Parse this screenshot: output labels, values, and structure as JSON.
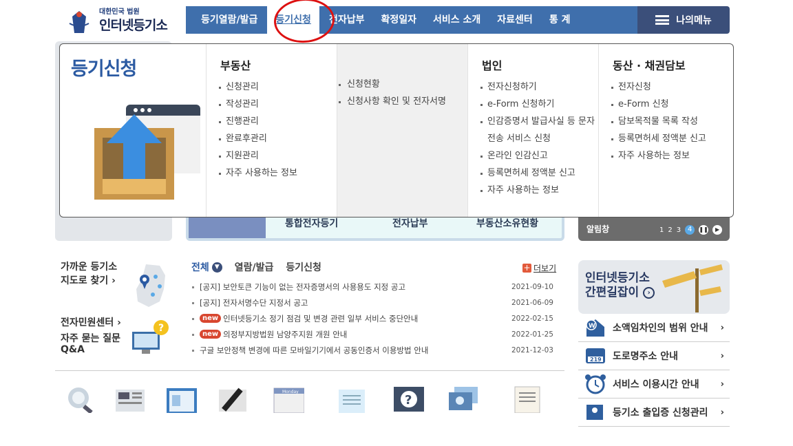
{
  "logo": {
    "small": "대한민국 법원",
    "big": "인터넷등기소"
  },
  "nav": {
    "items": [
      "등기열람/발급",
      "등기신청",
      "전자납부",
      "확정일자",
      "서비스 소개",
      "자료센터",
      "통 계"
    ],
    "active_index": 1,
    "my_menu": "나의메뉴"
  },
  "mega": {
    "title": "등기신청",
    "columns": [
      {
        "heading": "부동산",
        "items": [
          "신청관리",
          "작성관리",
          "진행관리",
          "완료후관리",
          "지원관리",
          "자주 사용하는 정보"
        ]
      },
      {
        "heading": "",
        "items": [
          "신청현황",
          "신청사항 확인 및 전자서명"
        ]
      },
      {
        "heading": "법인",
        "items": [
          "전자신청하기",
          "e-Form 신청하기",
          "인감증명서 발급사실 등 문자전송 서비스 신청",
          "온라인 인감신고",
          "등록면허세 정액분 신고",
          "자주 사용하는 정보"
        ]
      },
      {
        "heading": "동산 · 채권담보",
        "items": [
          "전자신청",
          "e-Form 신청",
          "담보목적물 목록 작성",
          "등록면허세 정액분 신고",
          "자주 사용하는 정보"
        ]
      }
    ]
  },
  "quick": {
    "items": [
      "통합전자등기",
      "전자납부",
      "부동산소유현황"
    ]
  },
  "notice_bar": {
    "label": "알림창",
    "pages": [
      "1",
      "2",
      "3",
      "4"
    ],
    "current": "4"
  },
  "left": {
    "near_line1": "가까운 등기소",
    "near_line2": "지도로 찾기 ›",
    "civil": "전자민원센터 ›",
    "faq_line1": "자주 묻는 질문",
    "faq_line2": "Q&A"
  },
  "news": {
    "tabs": [
      "전체",
      "열람/발급",
      "등기신청"
    ],
    "more": "더보기",
    "items": [
      {
        "badge": "",
        "text": "[공지] 보안토큰 기능이 없는 전자증명서의 사용용도 지정 공고",
        "date": "2021-09-10"
      },
      {
        "badge": "",
        "text": "[공지] 전자서명수단 지정서 공고",
        "date": "2021-06-09"
      },
      {
        "badge": "new",
        "text": "인터넷등기소 정기 점검 및 변경 관련 일부 서비스 중단안내",
        "date": "2022-02-15"
      },
      {
        "badge": "new",
        "text": "의정부지방법원 남양주지원 개원 안내",
        "date": "2022-01-25"
      },
      {
        "badge": "",
        "text": "구글 보안정책 변경에 따른 모바일기기에서 공동인증서 이용방법 안내",
        "date": "2021-12-03"
      }
    ]
  },
  "guide": {
    "line1": "인터넷등기소",
    "line2": "간편길잡이"
  },
  "links": [
    "소액임차인의 범위 안내",
    "도로명주소 안내",
    "서비스 이용시간 안내",
    "등기소 출입증 신청관리"
  ],
  "colors": {
    "nav": "#3f6fac",
    "mymenu": "#3b4f7a",
    "accent": "#2b5aa2",
    "badge": "#d8462f",
    "highlight": "#dd1111"
  }
}
